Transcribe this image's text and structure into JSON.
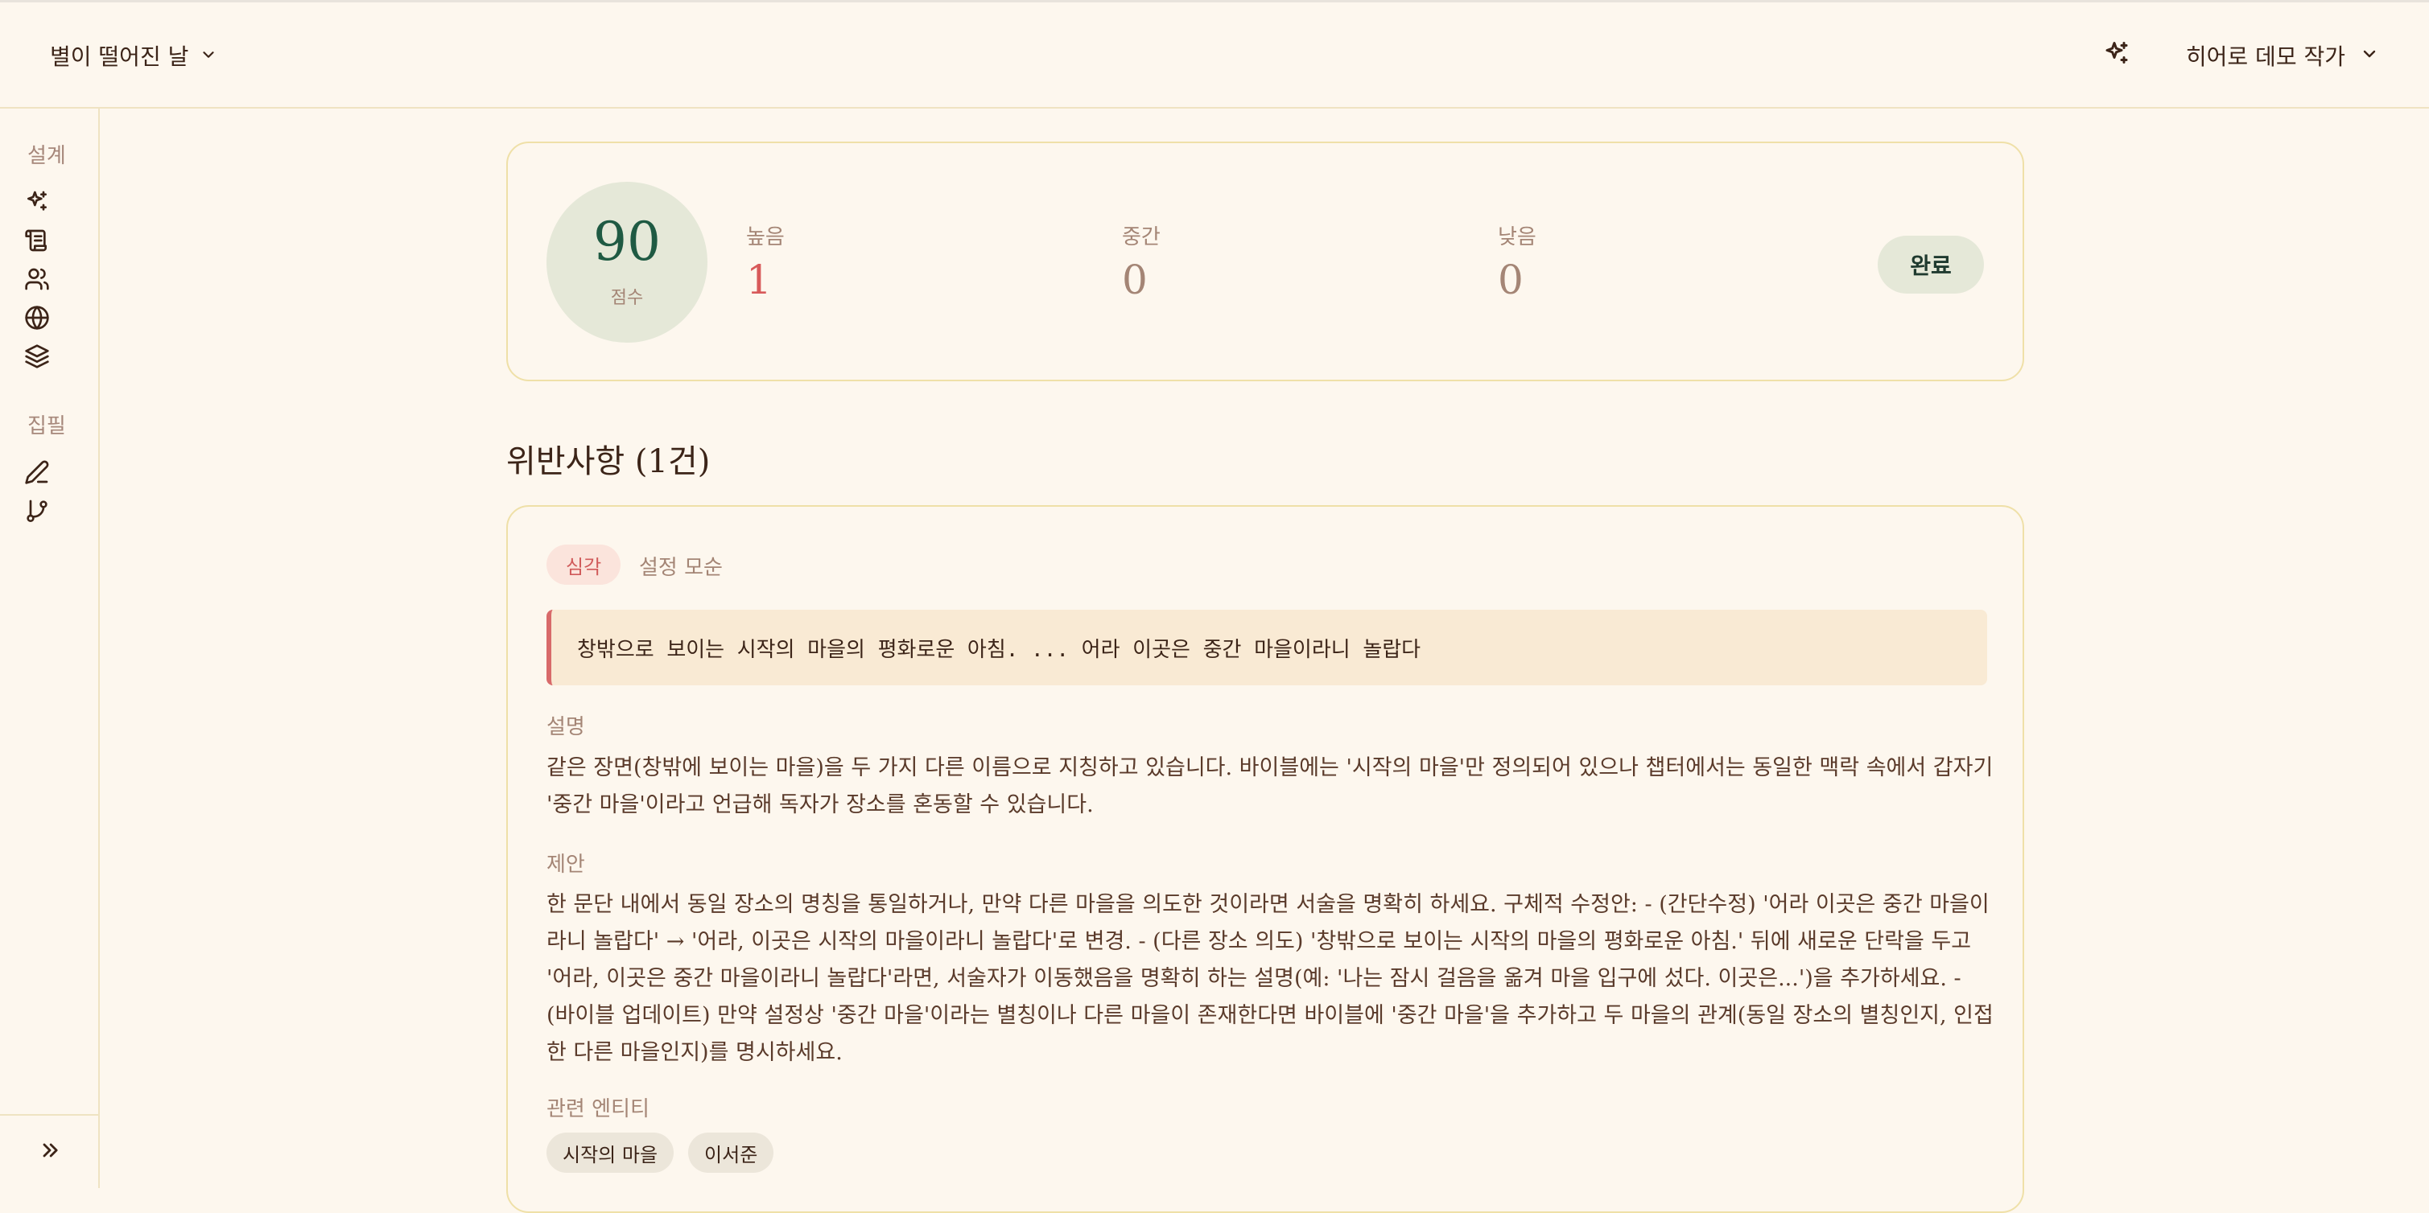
{
  "header": {
    "project_title": "별이 떨어진 날",
    "user_name": "히어로 데모 작가"
  },
  "sidebar": {
    "section_design": "설계",
    "section_writing": "집필",
    "design_icons": [
      "sparkle-icon",
      "scroll-icon",
      "users-icon",
      "globe-icon",
      "layers-icon"
    ],
    "writing_icons": [
      "pen-icon",
      "branch-icon"
    ],
    "expand_icon": "double-chevron-right-icon"
  },
  "score": {
    "value": "90",
    "label": "점수",
    "metrics": [
      {
        "label": "높음",
        "value": "1",
        "color": "#d85a5a"
      },
      {
        "label": "중간",
        "value": "0",
        "color": "#a48575"
      },
      {
        "label": "낮음",
        "value": "0",
        "color": "#a48575"
      }
    ],
    "done_label": "완료"
  },
  "violations": {
    "title": "위반사항 (1건)",
    "items": [
      {
        "severity": "심각",
        "type": "설정 모순",
        "quote": "창밖으로 보이는 시작의 마을의 평화로운 아침. ... 어라 이곳은 중간 마을이라니 놀랍다",
        "description_label": "설명",
        "description": "같은 장면(창밖에 보이는 마을)을 두 가지 다른 이름으로 지칭하고 있습니다. 바이블에는 '시작의 마을'만 정의되어 있으나 챕터에서는 동일한 맥락 속에서 갑자기 '중간 마을'이라고 언급해 독자가 장소를 혼동할 수 있습니다.",
        "suggestion_label": "제안",
        "suggestion": "한 문단 내에서 동일 장소의 명칭을 통일하거나, 만약 다른 마을을 의도한 것이라면 서술을 명확히 하세요. 구체적 수정안: - (간단수정) '어라 이곳은 중간 마을이라니 놀랍다' → '어라, 이곳은 시작의 마을이라니 놀랍다'로 변경. - (다른 장소 의도) '창밖으로 보이는 시작의 마을의 평화로운 아침.' 뒤에 새로운 단락을 두고 '어라, 이곳은 중간 마을이라니 놀랍다'라면, 서술자가 이동했음을 명확히 하는 설명(예: '나는 잠시 걸음을 옮겨 마을 입구에 섰다. 이곳은...')을 추가하세요. - (바이블 업데이트) 만약 설정상 '중간 마을'이라는 별칭이나 다른 마을이 존재한다면 바이블에 '중간 마을'을 추가하고 두 마을의 관계(동일 장소의 별칭인지, 인접한 다른 마을인지)를 명시하세요.",
        "entities_label": "관련 엔티티",
        "entities": [
          "시작의 마을",
          "이서준"
        ]
      }
    ]
  }
}
